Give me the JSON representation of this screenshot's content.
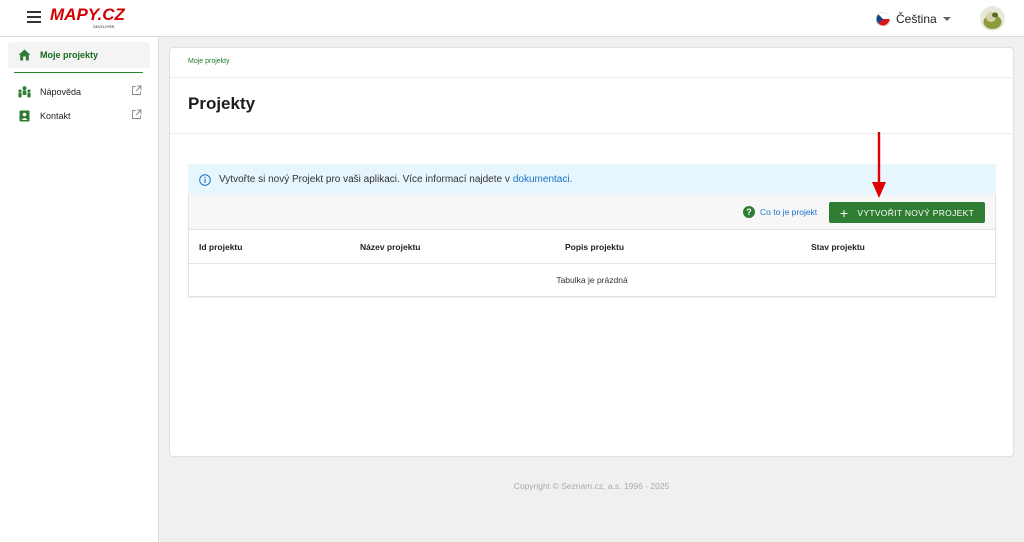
{
  "header": {
    "logo_text": "MAPY.CZ",
    "logo_subtext": "DEVELOPER",
    "language": "Čeština",
    "icons": {
      "menu": "hamburger-icon",
      "flag": "czech-flag-icon",
      "avatar": "user-avatar"
    }
  },
  "sidebar": {
    "items": [
      {
        "label": "Moje projekty",
        "icon": "home-icon",
        "active": true
      },
      {
        "label": "Nápověda",
        "icon": "help-people-icon",
        "external": true
      },
      {
        "label": "Kontakt",
        "icon": "contact-icon",
        "external": true
      }
    ]
  },
  "main": {
    "breadcrumb": "Moje projekty",
    "title": "Projekty",
    "info_text": "Vytvořte si nový Projekt pro vaši aplikaci. Více informací najdete v",
    "info_link": "dokumentaci.",
    "help_link": "Co to je projekt",
    "create_button": "VYTVOŘIT NOVÝ PROJEKT",
    "columns": [
      "Id projektu",
      "Název projektu",
      "Popis projektu",
      "Stav projektu"
    ],
    "empty_text": "Tabulka je prázdná"
  },
  "footer": {
    "copyright": "Copyright © Seznam.cz, a.s. 1996 - 2025"
  },
  "colors": {
    "primary_green": "#2e7d32",
    "link_blue": "#1a73c8",
    "info_bg": "#e7f5fd",
    "annotation_red": "#e00000"
  }
}
